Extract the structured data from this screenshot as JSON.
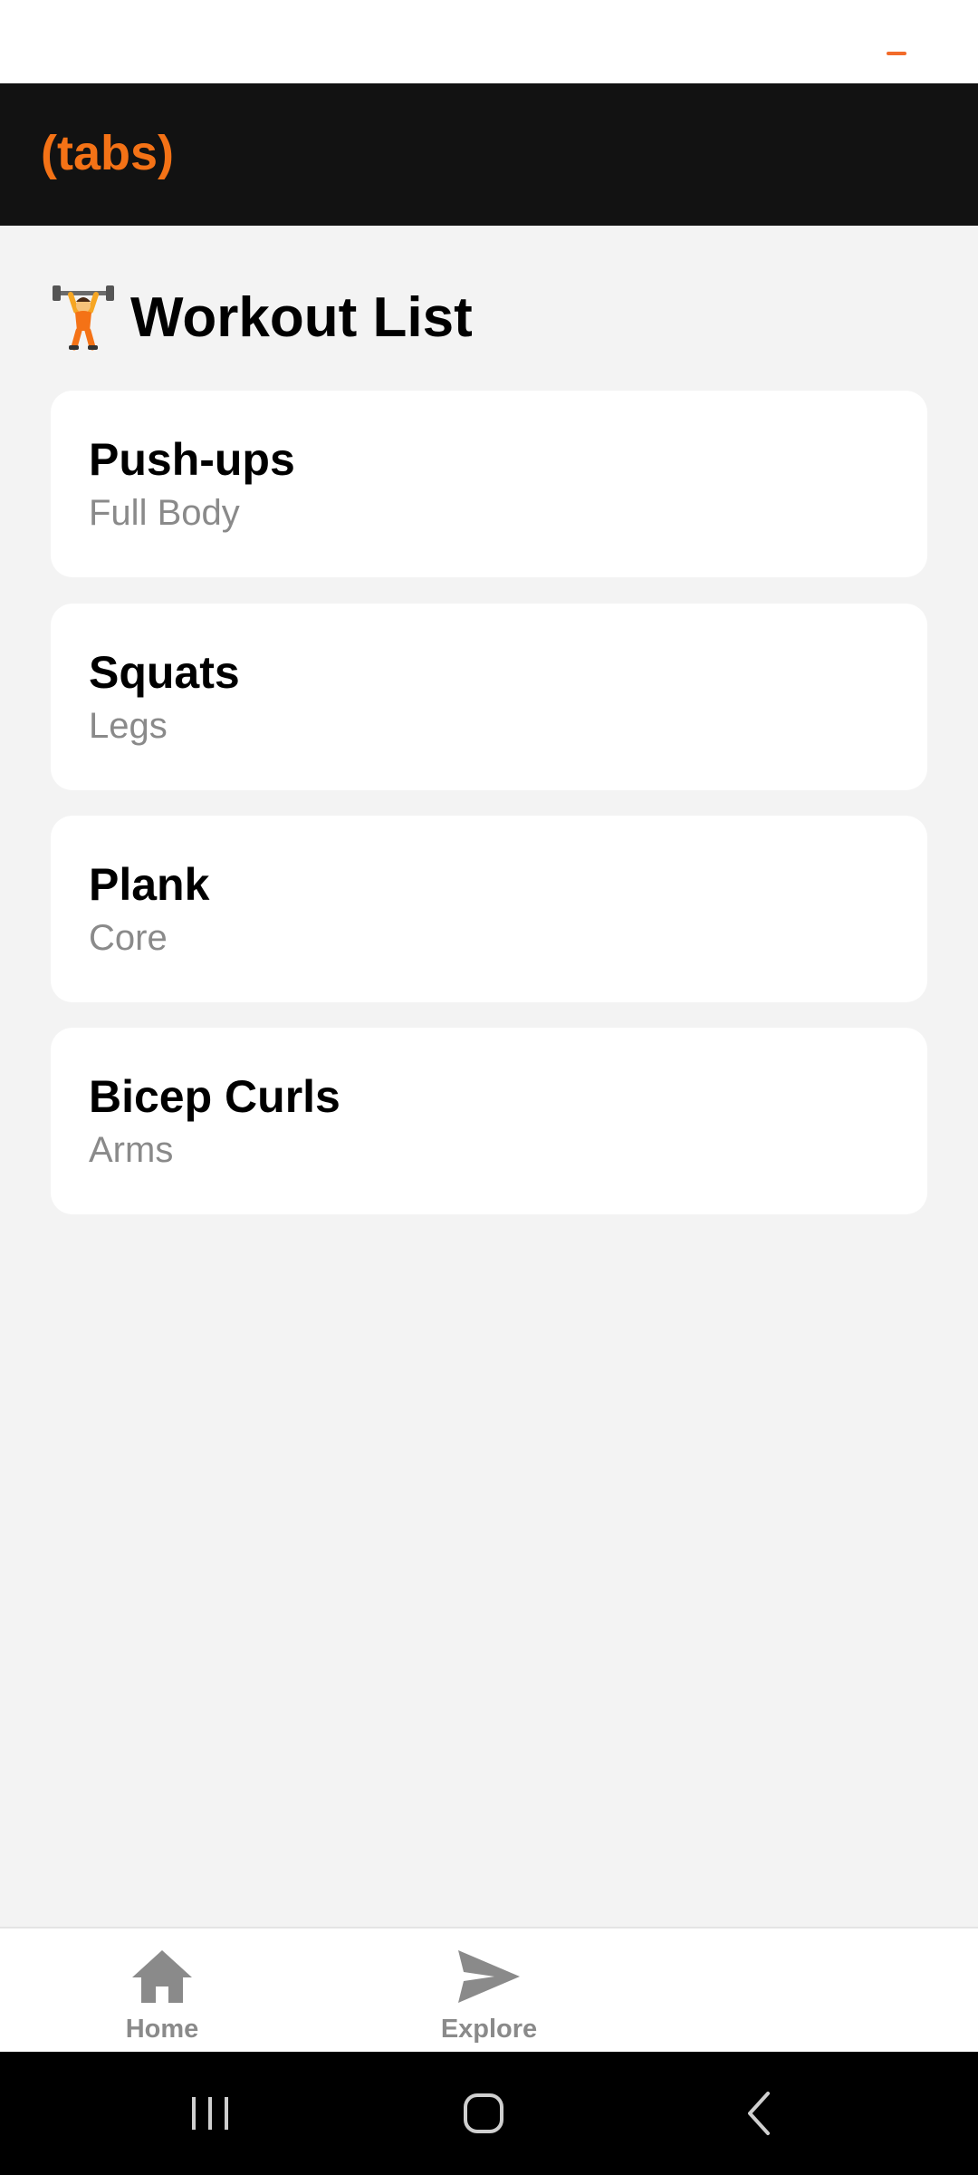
{
  "header": {
    "title": "(tabs)",
    "accent_color": "#f47216"
  },
  "page": {
    "title_icon": "weightlifter-icon",
    "title": "Workout List"
  },
  "workouts": [
    {
      "name": "Push-ups",
      "category": "Full Body"
    },
    {
      "name": "Squats",
      "category": "Legs"
    },
    {
      "name": "Plank",
      "category": "Core"
    },
    {
      "name": "Bicep Curls",
      "category": "Arms"
    }
  ],
  "tabs": [
    {
      "label": "Home",
      "icon": "home-icon"
    },
    {
      "label": "Explore",
      "icon": "paper-plane-icon"
    }
  ],
  "system_nav": {
    "buttons": [
      "recent-apps-icon",
      "home-circle-icon",
      "back-icon"
    ]
  },
  "colors": {
    "background": "#f3f3f3",
    "header_bg": "#121212",
    "card_bg": "#ffffff",
    "muted_text": "#8a8a8a"
  }
}
